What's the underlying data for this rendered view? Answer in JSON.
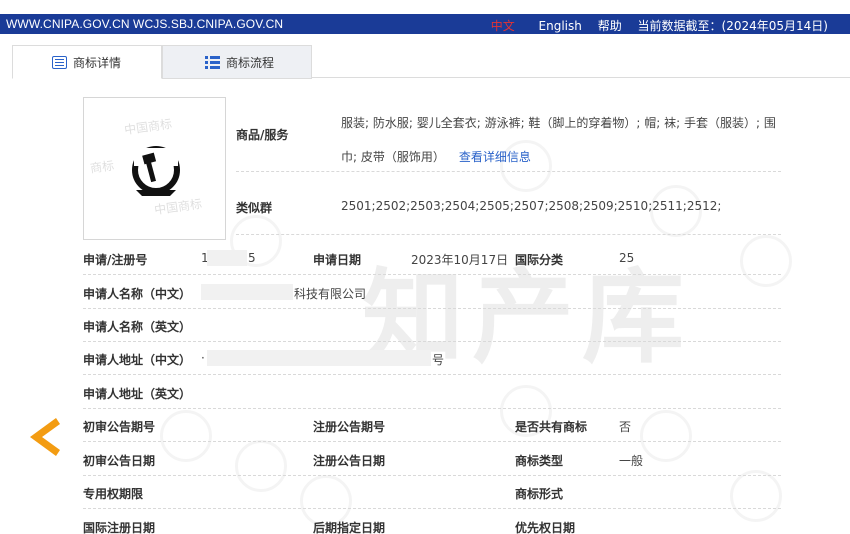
{
  "topbar": {
    "domain": "WWW.CNIPA.GOV.CN WCJS.SBJ.CNIPA.GOV.CN",
    "lang_zh": "中文",
    "lang_en": "English",
    "help": "帮助",
    "data_date": "当前数据截至：(2024年05月14日)"
  },
  "tabs": [
    {
      "label": "商标详情",
      "icon": "document-icon",
      "active": true
    },
    {
      "label": "商标流程",
      "icon": "list-icon",
      "active": false
    }
  ],
  "watermark": "知产库",
  "logo_watermark": [
    "中国商标",
    "商标"
  ],
  "goods": {
    "label": "商品/服务",
    "text": "服装; 防水服; 婴儿全套衣; 游泳裤; 鞋（脚上的穿着物）; 帽; 袜; 手套（服装）; 围巾; 皮带（服饰用）",
    "link": "查看详细信息"
  },
  "similar_group": {
    "label": "类似群",
    "value": "2501;2502;2503;2504;2505;2507;2508;2509;2510;2511;2512;"
  },
  "fields": {
    "reg_no": {
      "label": "申请/注册号",
      "prefix": "1",
      "suffix": "5"
    },
    "apply_date": {
      "label": "申请日期",
      "value": "2023年10月17日"
    },
    "intl_class": {
      "label": "国际分类",
      "value": "25"
    },
    "applicant_cn": {
      "label": "申请人名称（中文）",
      "value": "科技有限公司"
    },
    "applicant_en": {
      "label": "申请人名称（英文）",
      "value": ""
    },
    "address_cn": {
      "label": "申请人地址（中文）",
      "prefix": "·",
      "suffix": "号"
    },
    "address_en": {
      "label": "申请人地址（英文）",
      "value": ""
    },
    "prelim_pub_no": {
      "label": "初审公告期号",
      "value": ""
    },
    "reg_pub_no": {
      "label": "注册公告期号",
      "value": ""
    },
    "shared": {
      "label": "是否共有商标",
      "value": "否"
    },
    "prelim_pub_date": {
      "label": "初审公告日期",
      "value": ""
    },
    "reg_pub_date": {
      "label": "注册公告日期",
      "value": ""
    },
    "tm_type": {
      "label": "商标类型",
      "value": "一般"
    },
    "exclusive_period": {
      "label": "专用权期限",
      "value": ""
    },
    "tm_form": {
      "label": "商标形式",
      "value": ""
    },
    "intl_reg_date": {
      "label": "国际注册日期",
      "value": ""
    },
    "later_designation": {
      "label": "后期指定日期",
      "value": ""
    },
    "priority_date": {
      "label": "优先权日期",
      "value": ""
    }
  },
  "colors": {
    "topbar": "#1a3b97",
    "link": "#2a62c9",
    "arrow": "#f39c12",
    "lang_active": "#e43333"
  }
}
